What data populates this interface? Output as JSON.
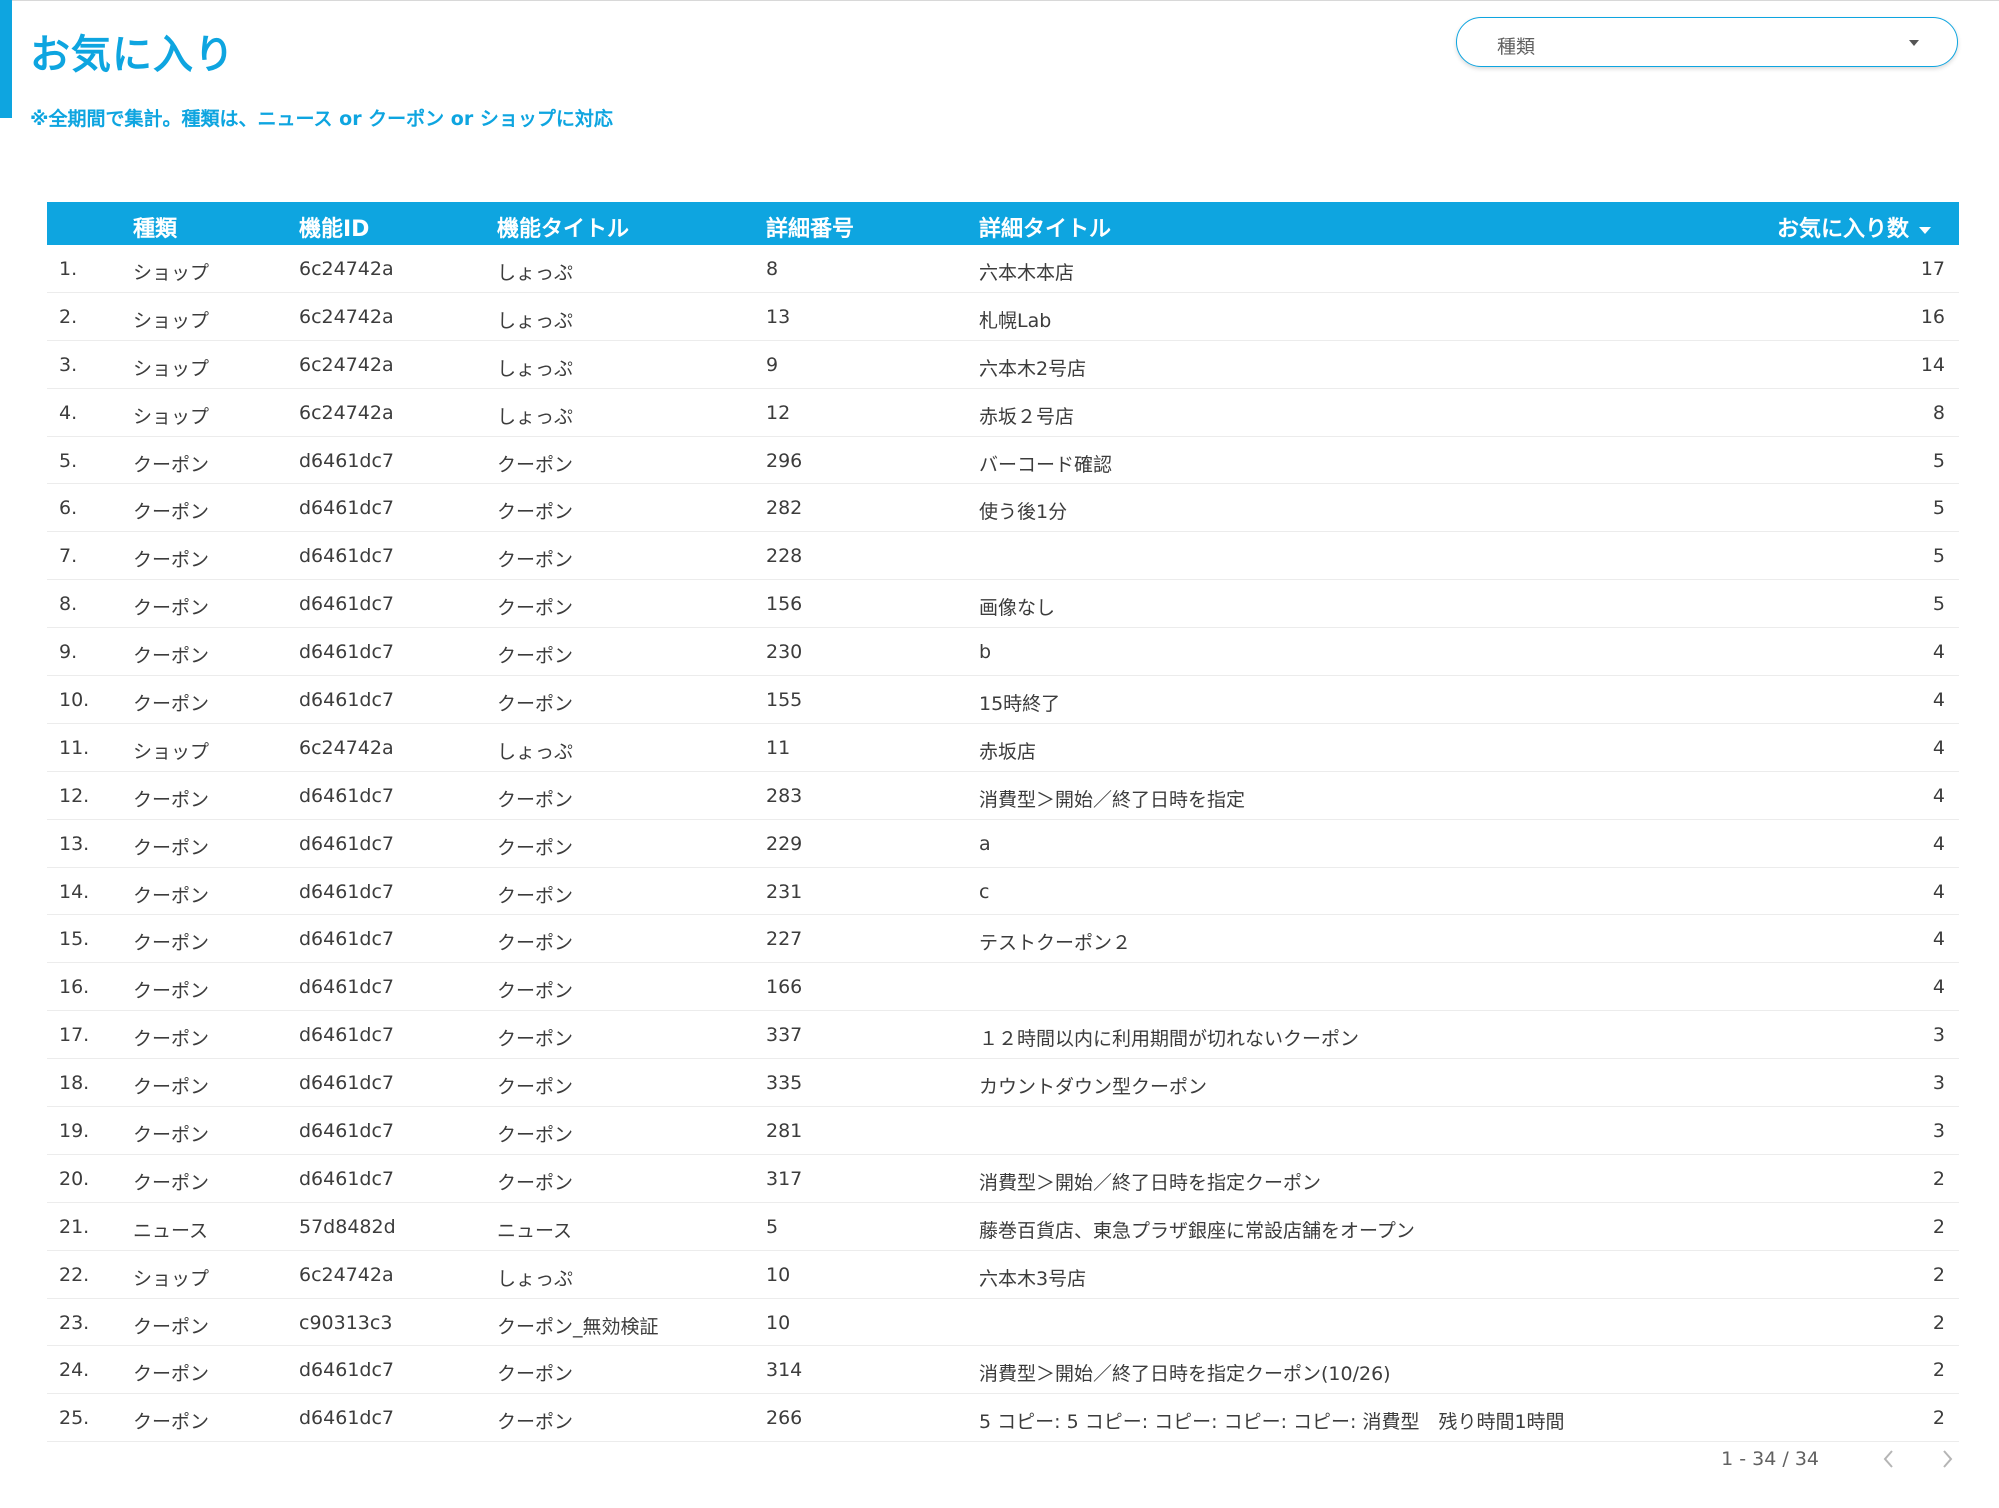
{
  "header": {
    "title": "お気に入り",
    "subtitle": "※全期間で集計。種類は、ニュース or クーポン or ショップに対応"
  },
  "filter": {
    "label": "種類",
    "icon": "dropdown-caret-icon"
  },
  "colors": {
    "accent": "#0ea5e0"
  },
  "table": {
    "columns": {
      "type": "種類",
      "feature_id": "機能ID",
      "feature_title": "機能タイトル",
      "detail_number": "詳細番号",
      "detail_title": "詳細タイトル",
      "favorites": "お気に入り数"
    },
    "sort": {
      "column": "favorites",
      "direction": "descending"
    },
    "rows": [
      {
        "num": "1.",
        "type": "ショップ",
        "id": "6c24742a",
        "ftitle": "しょっぷ",
        "dnum": "8",
        "dtitle": "六本木本店",
        "count": "17"
      },
      {
        "num": "2.",
        "type": "ショップ",
        "id": "6c24742a",
        "ftitle": "しょっぷ",
        "dnum": "13",
        "dtitle": "札幌Lab",
        "count": "16"
      },
      {
        "num": "3.",
        "type": "ショップ",
        "id": "6c24742a",
        "ftitle": "しょっぷ",
        "dnum": "9",
        "dtitle": "六本木2号店",
        "count": "14"
      },
      {
        "num": "4.",
        "type": "ショップ",
        "id": "6c24742a",
        "ftitle": "しょっぷ",
        "dnum": "12",
        "dtitle": "赤坂２号店",
        "count": "8"
      },
      {
        "num": "5.",
        "type": "クーポン",
        "id": "d6461dc7",
        "ftitle": "クーポン",
        "dnum": "296",
        "dtitle": "バーコード確認",
        "count": "5"
      },
      {
        "num": "6.",
        "type": "クーポン",
        "id": "d6461dc7",
        "ftitle": "クーポン",
        "dnum": "282",
        "dtitle": "使う後1分",
        "count": "5"
      },
      {
        "num": "7.",
        "type": "クーポン",
        "id": "d6461dc7",
        "ftitle": "クーポン",
        "dnum": "228",
        "dtitle": "",
        "count": "5"
      },
      {
        "num": "8.",
        "type": "クーポン",
        "id": "d6461dc7",
        "ftitle": "クーポン",
        "dnum": "156",
        "dtitle": "画像なし",
        "count": "5"
      },
      {
        "num": "9.",
        "type": "クーポン",
        "id": "d6461dc7",
        "ftitle": "クーポン",
        "dnum": "230",
        "dtitle": "b",
        "count": "4"
      },
      {
        "num": "10.",
        "type": "クーポン",
        "id": "d6461dc7",
        "ftitle": "クーポン",
        "dnum": "155",
        "dtitle": "15時終了",
        "count": "4"
      },
      {
        "num": "11.",
        "type": "ショップ",
        "id": "6c24742a",
        "ftitle": "しょっぷ",
        "dnum": "11",
        "dtitle": "赤坂店",
        "count": "4"
      },
      {
        "num": "12.",
        "type": "クーポン",
        "id": "d6461dc7",
        "ftitle": "クーポン",
        "dnum": "283",
        "dtitle": "消費型＞開始／終了日時を指定",
        "count": "4"
      },
      {
        "num": "13.",
        "type": "クーポン",
        "id": "d6461dc7",
        "ftitle": "クーポン",
        "dnum": "229",
        "dtitle": "a",
        "count": "4"
      },
      {
        "num": "14.",
        "type": "クーポン",
        "id": "d6461dc7",
        "ftitle": "クーポン",
        "dnum": "231",
        "dtitle": "c",
        "count": "4"
      },
      {
        "num": "15.",
        "type": "クーポン",
        "id": "d6461dc7",
        "ftitle": "クーポン",
        "dnum": "227",
        "dtitle": "テストクーポン２",
        "count": "4"
      },
      {
        "num": "16.",
        "type": "クーポン",
        "id": "d6461dc7",
        "ftitle": "クーポン",
        "dnum": "166",
        "dtitle": "",
        "count": "4"
      },
      {
        "num": "17.",
        "type": "クーポン",
        "id": "d6461dc7",
        "ftitle": "クーポン",
        "dnum": "337",
        "dtitle": "１２時間以内に利用期間が切れないクーポン",
        "count": "3"
      },
      {
        "num": "18.",
        "type": "クーポン",
        "id": "d6461dc7",
        "ftitle": "クーポン",
        "dnum": "335",
        "dtitle": "カウントダウン型クーポン",
        "count": "3"
      },
      {
        "num": "19.",
        "type": "クーポン",
        "id": "d6461dc7",
        "ftitle": "クーポン",
        "dnum": "281",
        "dtitle": "",
        "count": "3"
      },
      {
        "num": "20.",
        "type": "クーポン",
        "id": "d6461dc7",
        "ftitle": "クーポン",
        "dnum": "317",
        "dtitle": "消費型＞開始／終了日時を指定クーポン",
        "count": "2"
      },
      {
        "num": "21.",
        "type": "ニュース",
        "id": "57d8482d",
        "ftitle": "ニュース",
        "dnum": "5",
        "dtitle": "藤巻百貨店、東急プラザ銀座に常設店舗をオープン",
        "count": "2"
      },
      {
        "num": "22.",
        "type": "ショップ",
        "id": "6c24742a",
        "ftitle": "しょっぷ",
        "dnum": "10",
        "dtitle": "六本木3号店",
        "count": "2"
      },
      {
        "num": "23.",
        "type": "クーポン",
        "id": "c90313c3",
        "ftitle": "クーポン_無効検証",
        "dnum": "10",
        "dtitle": "",
        "count": "2"
      },
      {
        "num": "24.",
        "type": "クーポン",
        "id": "d6461dc7",
        "ftitle": "クーポン",
        "dnum": "314",
        "dtitle": "消費型＞開始／終了日時を指定クーポン(10/26)",
        "count": "2"
      },
      {
        "num": "25.",
        "type": "クーポン",
        "id": "d6461dc7",
        "ftitle": "クーポン",
        "dnum": "266",
        "dtitle": "5 コピー: 5 コピー: コピー: コピー: コピー: 消費型　残り時間1時間",
        "count": "2"
      }
    ]
  },
  "pagination": {
    "range": "1 - 34 / 34",
    "prev_icon": "chevron-left-icon",
    "next_icon": "chevron-right-icon"
  }
}
